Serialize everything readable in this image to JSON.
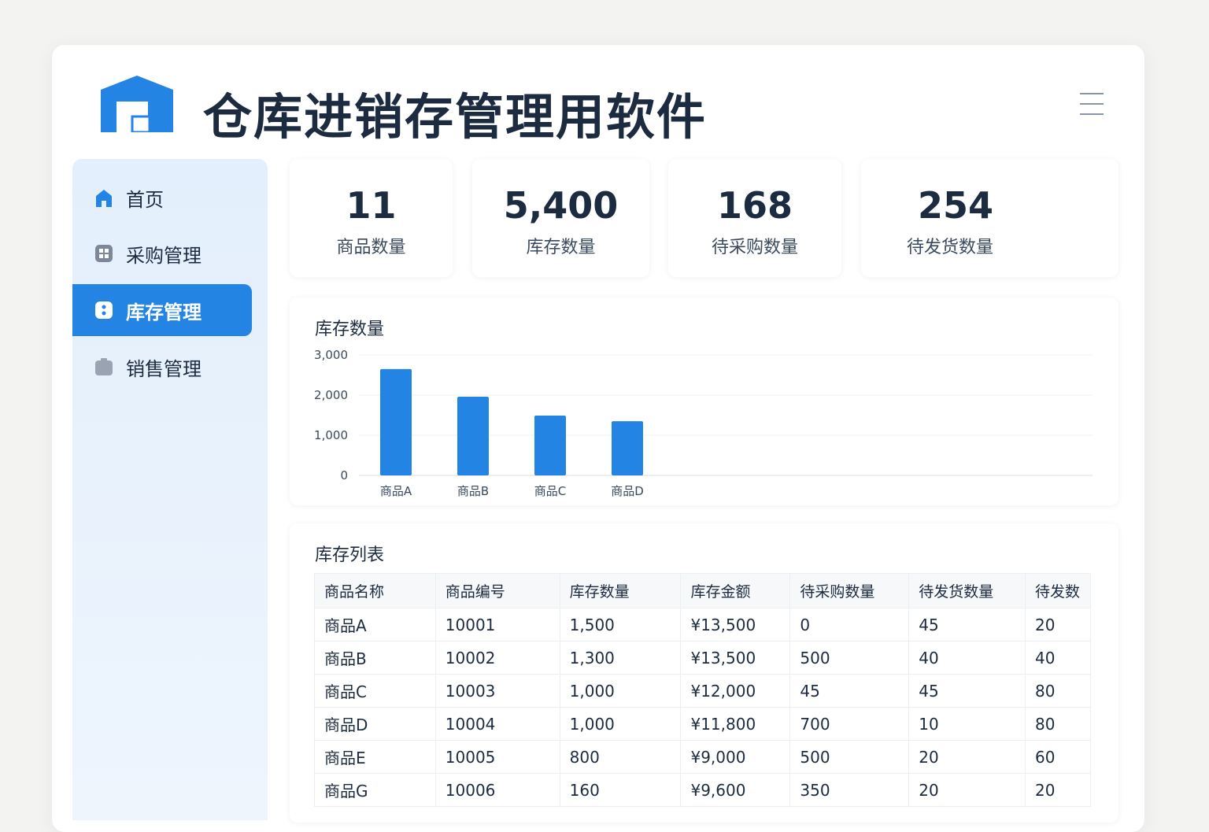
{
  "app": {
    "title": "仓库进销存管理用软件"
  },
  "sidebar": {
    "items": [
      {
        "label": "首页"
      },
      {
        "label": "采购管理"
      },
      {
        "label": "库存管理"
      },
      {
        "label": "销售管理"
      }
    ]
  },
  "stats": [
    {
      "value": "11",
      "label": "商品数量"
    },
    {
      "value": "5,400",
      "label": "库存数量"
    },
    {
      "value": "168",
      "label": "待采购数量"
    },
    {
      "value": "254",
      "label": "待发货数量"
    }
  ],
  "chart_data": {
    "type": "bar",
    "title": "库存数量",
    "categories": [
      "商品A",
      "商品B",
      "商品C",
      "商品D"
    ],
    "values": [
      2650,
      1960,
      1490,
      1350
    ],
    "yticks": [
      "0",
      "1,000",
      "2,000",
      "3,000"
    ],
    "ylim": [
      0,
      3000
    ],
    "color": "#2384e4"
  },
  "table": {
    "title": "库存列表",
    "headers": [
      "商品名称",
      "商品编号",
      "库存数量",
      "库存金额",
      "待采购数量",
      "待发货数量",
      "待发数"
    ],
    "rows": [
      [
        "商品A",
        "10001",
        "1,500",
        "¥13,500",
        "0",
        "45",
        "20"
      ],
      [
        "商品B",
        "10002",
        "1,300",
        "¥13,500",
        "500",
        "40",
        "40"
      ],
      [
        "商品C",
        "10003",
        "1,000",
        "¥12,000",
        "45",
        "45",
        "80"
      ],
      [
        "商品D",
        "10004",
        "1,000",
        "¥11,800",
        "700",
        "10",
        "80"
      ],
      [
        "商品E",
        "10005",
        "800",
        "¥9,000",
        "500",
        "20",
        "60"
      ],
      [
        "商品G",
        "10006",
        "160",
        "¥9,600",
        "350",
        "20",
        "20"
      ]
    ]
  }
}
